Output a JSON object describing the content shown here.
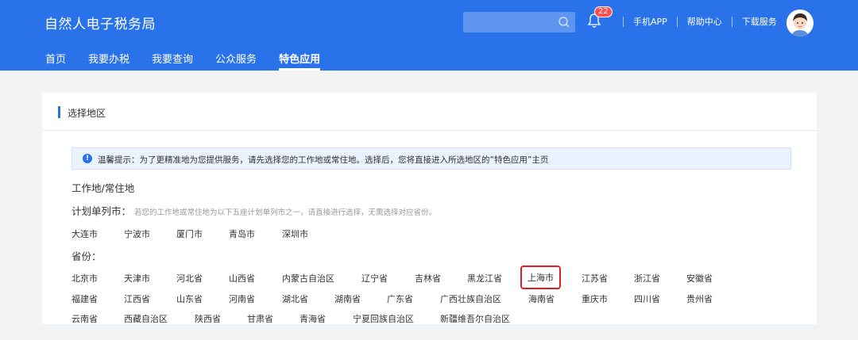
{
  "header": {
    "logo": "自然人电子税务局",
    "search_placeholder": "",
    "badge_count": "22",
    "links": [
      "手机APP",
      "帮助中心",
      "下载服务"
    ]
  },
  "nav": [
    "首页",
    "我要办税",
    "我要查询",
    "公众服务",
    "特色应用"
  ],
  "card": {
    "title": "选择地区",
    "tip": "温馨提示：为了更精准地为您提供服务，请先选择您的工作地或常住地。选择后，您将直接进入所选地区的“特色应用”主页",
    "work_label": "工作地/常住地",
    "plan_label": "计划单列市：",
    "plan_hint": "若您的工作地或常住地为以下五座计划单列市之一，请直接进行选择，无需选择对应省份。",
    "plan_cities": [
      "大连市",
      "宁波市",
      "厦门市",
      "青岛市",
      "深圳市"
    ],
    "province_label": "省份：",
    "provinces_row1": [
      "北京市",
      "天津市",
      "河北省",
      "山西省",
      "内蒙古自治区",
      "辽宁省",
      "吉林省",
      "黑龙江省",
      "上海市",
      "江苏省",
      "浙江省",
      "安徽省"
    ],
    "provinces_row2": [
      "福建省",
      "江西省",
      "山东省",
      "河南省",
      "湖北省",
      "湖南省",
      "广东省",
      "广西壮族自治区",
      "海南省",
      "重庆市",
      "四川省",
      "贵州省"
    ],
    "provinces_row3": [
      "云南省",
      "西藏自治区",
      "陕西省",
      "甘肃省",
      "青海省",
      "宁夏回族自治区",
      "新疆维吾尔自治区"
    ],
    "selected": "上海市"
  },
  "colors": {
    "header_blue": "#2a72ea",
    "highlight_red": "#e02020"
  }
}
